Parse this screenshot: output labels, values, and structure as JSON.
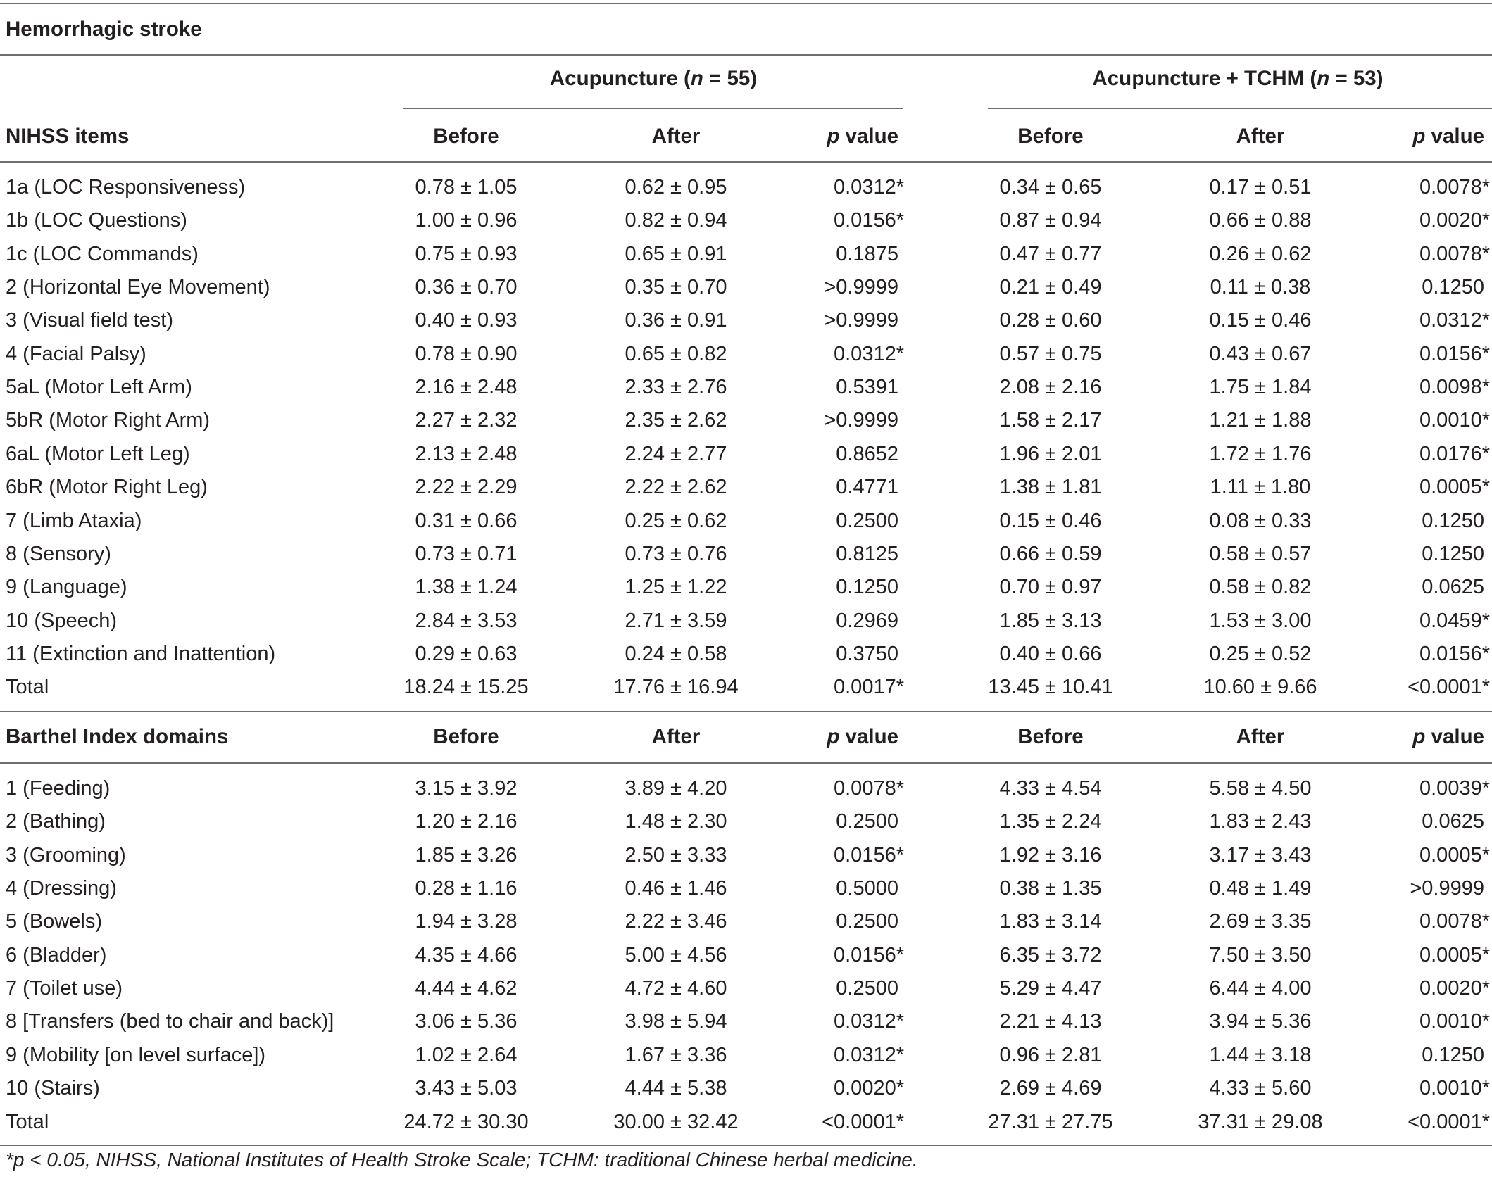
{
  "table": {
    "title": "Hemorrhagic stroke",
    "group_a": {
      "label": "Acupuncture (",
      "n_symbol": "n",
      "n_value": " = 55)"
    },
    "group_b": {
      "label": "Acupuncture + TCHM (",
      "n_symbol": "n",
      "n_value": " = 53)"
    },
    "col_before": "Before",
    "col_after": "After",
    "col_p_symbol": "p",
    "col_p_rest": " value",
    "nihss": {
      "header": "NIHSS items",
      "rows": [
        [
          "1a (LOC Responsiveness)",
          "0.78 ± 1.05",
          "0.62 ± 0.95",
          "0.0312*",
          "0.34 ± 0.65",
          "0.17 ± 0.51",
          "0.0078*"
        ],
        [
          "1b (LOC Questions)",
          "1.00 ± 0.96",
          "0.82 ± 0.94",
          "0.0156*",
          "0.87 ± 0.94",
          "0.66 ± 0.88",
          "0.0020*"
        ],
        [
          "1c (LOC Commands)",
          "0.75 ± 0.93",
          "0.65 ± 0.91",
          "0.1875",
          "0.47 ± 0.77",
          "0.26 ± 0.62",
          "0.0078*"
        ],
        [
          "2 (Horizontal Eye Movement)",
          "0.36 ± 0.70",
          "0.35 ± 0.70",
          ">0.9999",
          "0.21 ± 0.49",
          "0.11 ± 0.38",
          "0.1250"
        ],
        [
          "3 (Visual field test)",
          "0.40 ± 0.93",
          "0.36 ± 0.91",
          ">0.9999",
          "0.28 ± 0.60",
          "0.15 ± 0.46",
          "0.0312*"
        ],
        [
          "4 (Facial Palsy)",
          "0.78 ± 0.90",
          "0.65 ± 0.82",
          "0.0312*",
          "0.57 ± 0.75",
          "0.43 ± 0.67",
          "0.0156*"
        ],
        [
          "5aL (Motor Left Arm)",
          "2.16 ± 2.48",
          "2.33 ± 2.76",
          "0.5391",
          "2.08 ± 2.16",
          "1.75 ± 1.84",
          "0.0098*"
        ],
        [
          "5bR (Motor Right Arm)",
          "2.27 ± 2.32",
          "2.35 ± 2.62",
          ">0.9999",
          "1.58 ± 2.17",
          "1.21 ± 1.88",
          "0.0010*"
        ],
        [
          "6aL (Motor Left Leg)",
          "2.13 ± 2.48",
          "2.24 ± 2.77",
          "0.8652",
          "1.96 ± 2.01",
          "1.72 ± 1.76",
          "0.0176*"
        ],
        [
          "6bR (Motor Right Leg)",
          "2.22 ± 2.29",
          "2.22 ± 2.62",
          "0.4771",
          "1.38 ± 1.81",
          "1.11 ± 1.80",
          "0.0005*"
        ],
        [
          "7 (Limb Ataxia)",
          "0.31 ± 0.66",
          "0.25 ± 0.62",
          "0.2500",
          "0.15 ± 0.46",
          "0.08 ± 0.33",
          "0.1250"
        ],
        [
          "8 (Sensory)",
          "0.73 ± 0.71",
          "0.73 ± 0.76",
          "0.8125",
          "0.66 ± 0.59",
          "0.58 ± 0.57",
          "0.1250"
        ],
        [
          "9 (Language)",
          "1.38 ± 1.24",
          "1.25 ± 1.22",
          "0.1250",
          "0.70 ± 0.97",
          "0.58 ± 0.82",
          "0.0625"
        ],
        [
          "10 (Speech)",
          "2.84 ± 3.53",
          "2.71 ± 3.59",
          "0.2969",
          "1.85 ± 3.13",
          "1.53 ± 3.00",
          "0.0459*"
        ],
        [
          "11 (Extinction and Inattention)",
          "0.29 ± 0.63",
          "0.24 ± 0.58",
          "0.3750",
          "0.40 ± 0.66",
          "0.25 ± 0.52",
          "0.0156*"
        ],
        [
          "Total",
          "18.24 ± 15.25",
          "17.76 ± 16.94",
          "0.0017*",
          "13.45 ± 10.41",
          "10.60 ± 9.66",
          "<0.0001*"
        ]
      ]
    },
    "barthel": {
      "header": "Barthel Index domains",
      "rows": [
        [
          "1 (Feeding)",
          "3.15 ± 3.92",
          "3.89 ± 4.20",
          "0.0078*",
          "4.33 ± 4.54",
          "5.58 ± 4.50",
          "0.0039*"
        ],
        [
          "2 (Bathing)",
          "1.20 ± 2.16",
          "1.48 ± 2.30",
          "0.2500",
          "1.35 ± 2.24",
          "1.83 ± 2.43",
          "0.0625"
        ],
        [
          "3 (Grooming)",
          "1.85 ± 3.26",
          "2.50 ± 3.33",
          "0.0156*",
          "1.92 ± 3.16",
          "3.17 ± 3.43",
          "0.0005*"
        ],
        [
          "4 (Dressing)",
          "0.28 ± 1.16",
          "0.46 ± 1.46",
          "0.5000",
          "0.38 ± 1.35",
          "0.48 ± 1.49",
          ">0.9999"
        ],
        [
          "5 (Bowels)",
          "1.94 ± 3.28",
          "2.22 ± 3.46",
          "0.2500",
          "1.83 ± 3.14",
          "2.69 ± 3.35",
          "0.0078*"
        ],
        [
          "6 (Bladder)",
          "4.35 ± 4.66",
          "5.00 ± 4.56",
          "0.0156*",
          "6.35 ± 3.72",
          "7.50 ± 3.50",
          "0.0005*"
        ],
        [
          "7 (Toilet use)",
          "4.44 ± 4.62",
          "4.72 ± 4.60",
          "0.2500",
          "5.29 ± 4.47",
          "6.44 ± 4.00",
          "0.0020*"
        ],
        [
          "8 [Transfers (bed to chair and back)]",
          "3.06 ± 5.36",
          "3.98 ± 5.94",
          "0.0312*",
          "2.21 ± 4.13",
          "3.94 ± 5.36",
          "0.0010*"
        ],
        [
          "9 (Mobility [on level surface])",
          "1.02 ± 2.64",
          "1.67 ± 3.36",
          "0.0312*",
          "0.96 ± 2.81",
          "1.44 ± 3.18",
          "0.1250"
        ],
        [
          "10 (Stairs)",
          "3.43 ± 5.03",
          "4.44 ± 5.38",
          "0.0020*",
          "2.69 ± 4.69",
          "4.33 ± 5.60",
          "0.0010*"
        ],
        [
          "Total",
          "24.72 ± 30.30",
          "30.00 ± 32.42",
          "<0.0001*",
          "27.31 ± 27.75",
          "37.31 ± 29.08",
          "<0.0001*"
        ]
      ]
    },
    "footnote": "*p < 0.05, NIHSS, National Institutes of Health Stroke Scale; TCHM: traditional Chinese herbal medicine."
  }
}
